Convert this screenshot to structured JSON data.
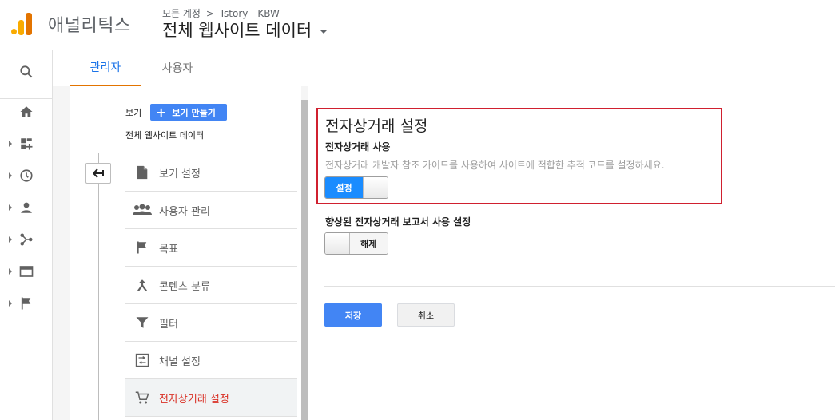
{
  "header": {
    "app_name": "애널리틱스",
    "breadcrumb_root": "모든 계정",
    "breadcrumb_chevron": ">",
    "breadcrumb_account": "Tstory - KBW",
    "view_title": "전체 웹사이트 데이터"
  },
  "rail": {
    "items": [
      {
        "icon": "search-icon"
      },
      {
        "icon": "home-icon"
      },
      {
        "icon": "customization-icon"
      },
      {
        "icon": "realtime-clock-icon"
      },
      {
        "icon": "audience-person-icon"
      },
      {
        "icon": "acquisition-icon"
      },
      {
        "icon": "behavior-icon"
      },
      {
        "icon": "conversions-flag-icon"
      }
    ]
  },
  "tabs": [
    {
      "label": "관리자",
      "active": true
    },
    {
      "label": "사용자",
      "active": false
    }
  ],
  "admin": {
    "view_label": "보기",
    "create_view_label": "보기 만들기",
    "view_name": "전체 웹사이트 데이터",
    "menu": [
      {
        "label": "보기 설정",
        "icon": "document-icon",
        "active": false
      },
      {
        "label": "사용자 관리",
        "icon": "people-icon",
        "active": false
      },
      {
        "label": "목표",
        "icon": "flag-icon",
        "active": false
      },
      {
        "label": "콘텐츠 분류",
        "icon": "merge-arrow-icon",
        "active": false
      },
      {
        "label": "필터",
        "icon": "filter-icon",
        "active": false
      },
      {
        "label": "채널 설정",
        "icon": "channel-icon",
        "active": false
      },
      {
        "label": "전자상거래 설정",
        "icon": "cart-icon",
        "active": true
      }
    ]
  },
  "settings": {
    "title": "전자상거래 설정",
    "enable_label": "전자상거래 사용",
    "enable_description": "전자상거래 개발자 참조 가이드를 사용하여 사이트에 적합한 추적 코드를 설정하세요.",
    "enable_toggle_label": "설정",
    "enable_toggle_state": "on",
    "enhanced_label": "향상된 전자상거래 보고서 사용 설정",
    "enhanced_toggle_label": "해제",
    "enhanced_toggle_state": "off",
    "save_label": "저장",
    "cancel_label": "취소"
  },
  "colors": {
    "accent_blue": "#1a73e8",
    "toggle_on": "#1a8cff",
    "active_menu_red": "#d93025",
    "highlight_border": "#d0202f",
    "tab_underline": "#e37400"
  }
}
